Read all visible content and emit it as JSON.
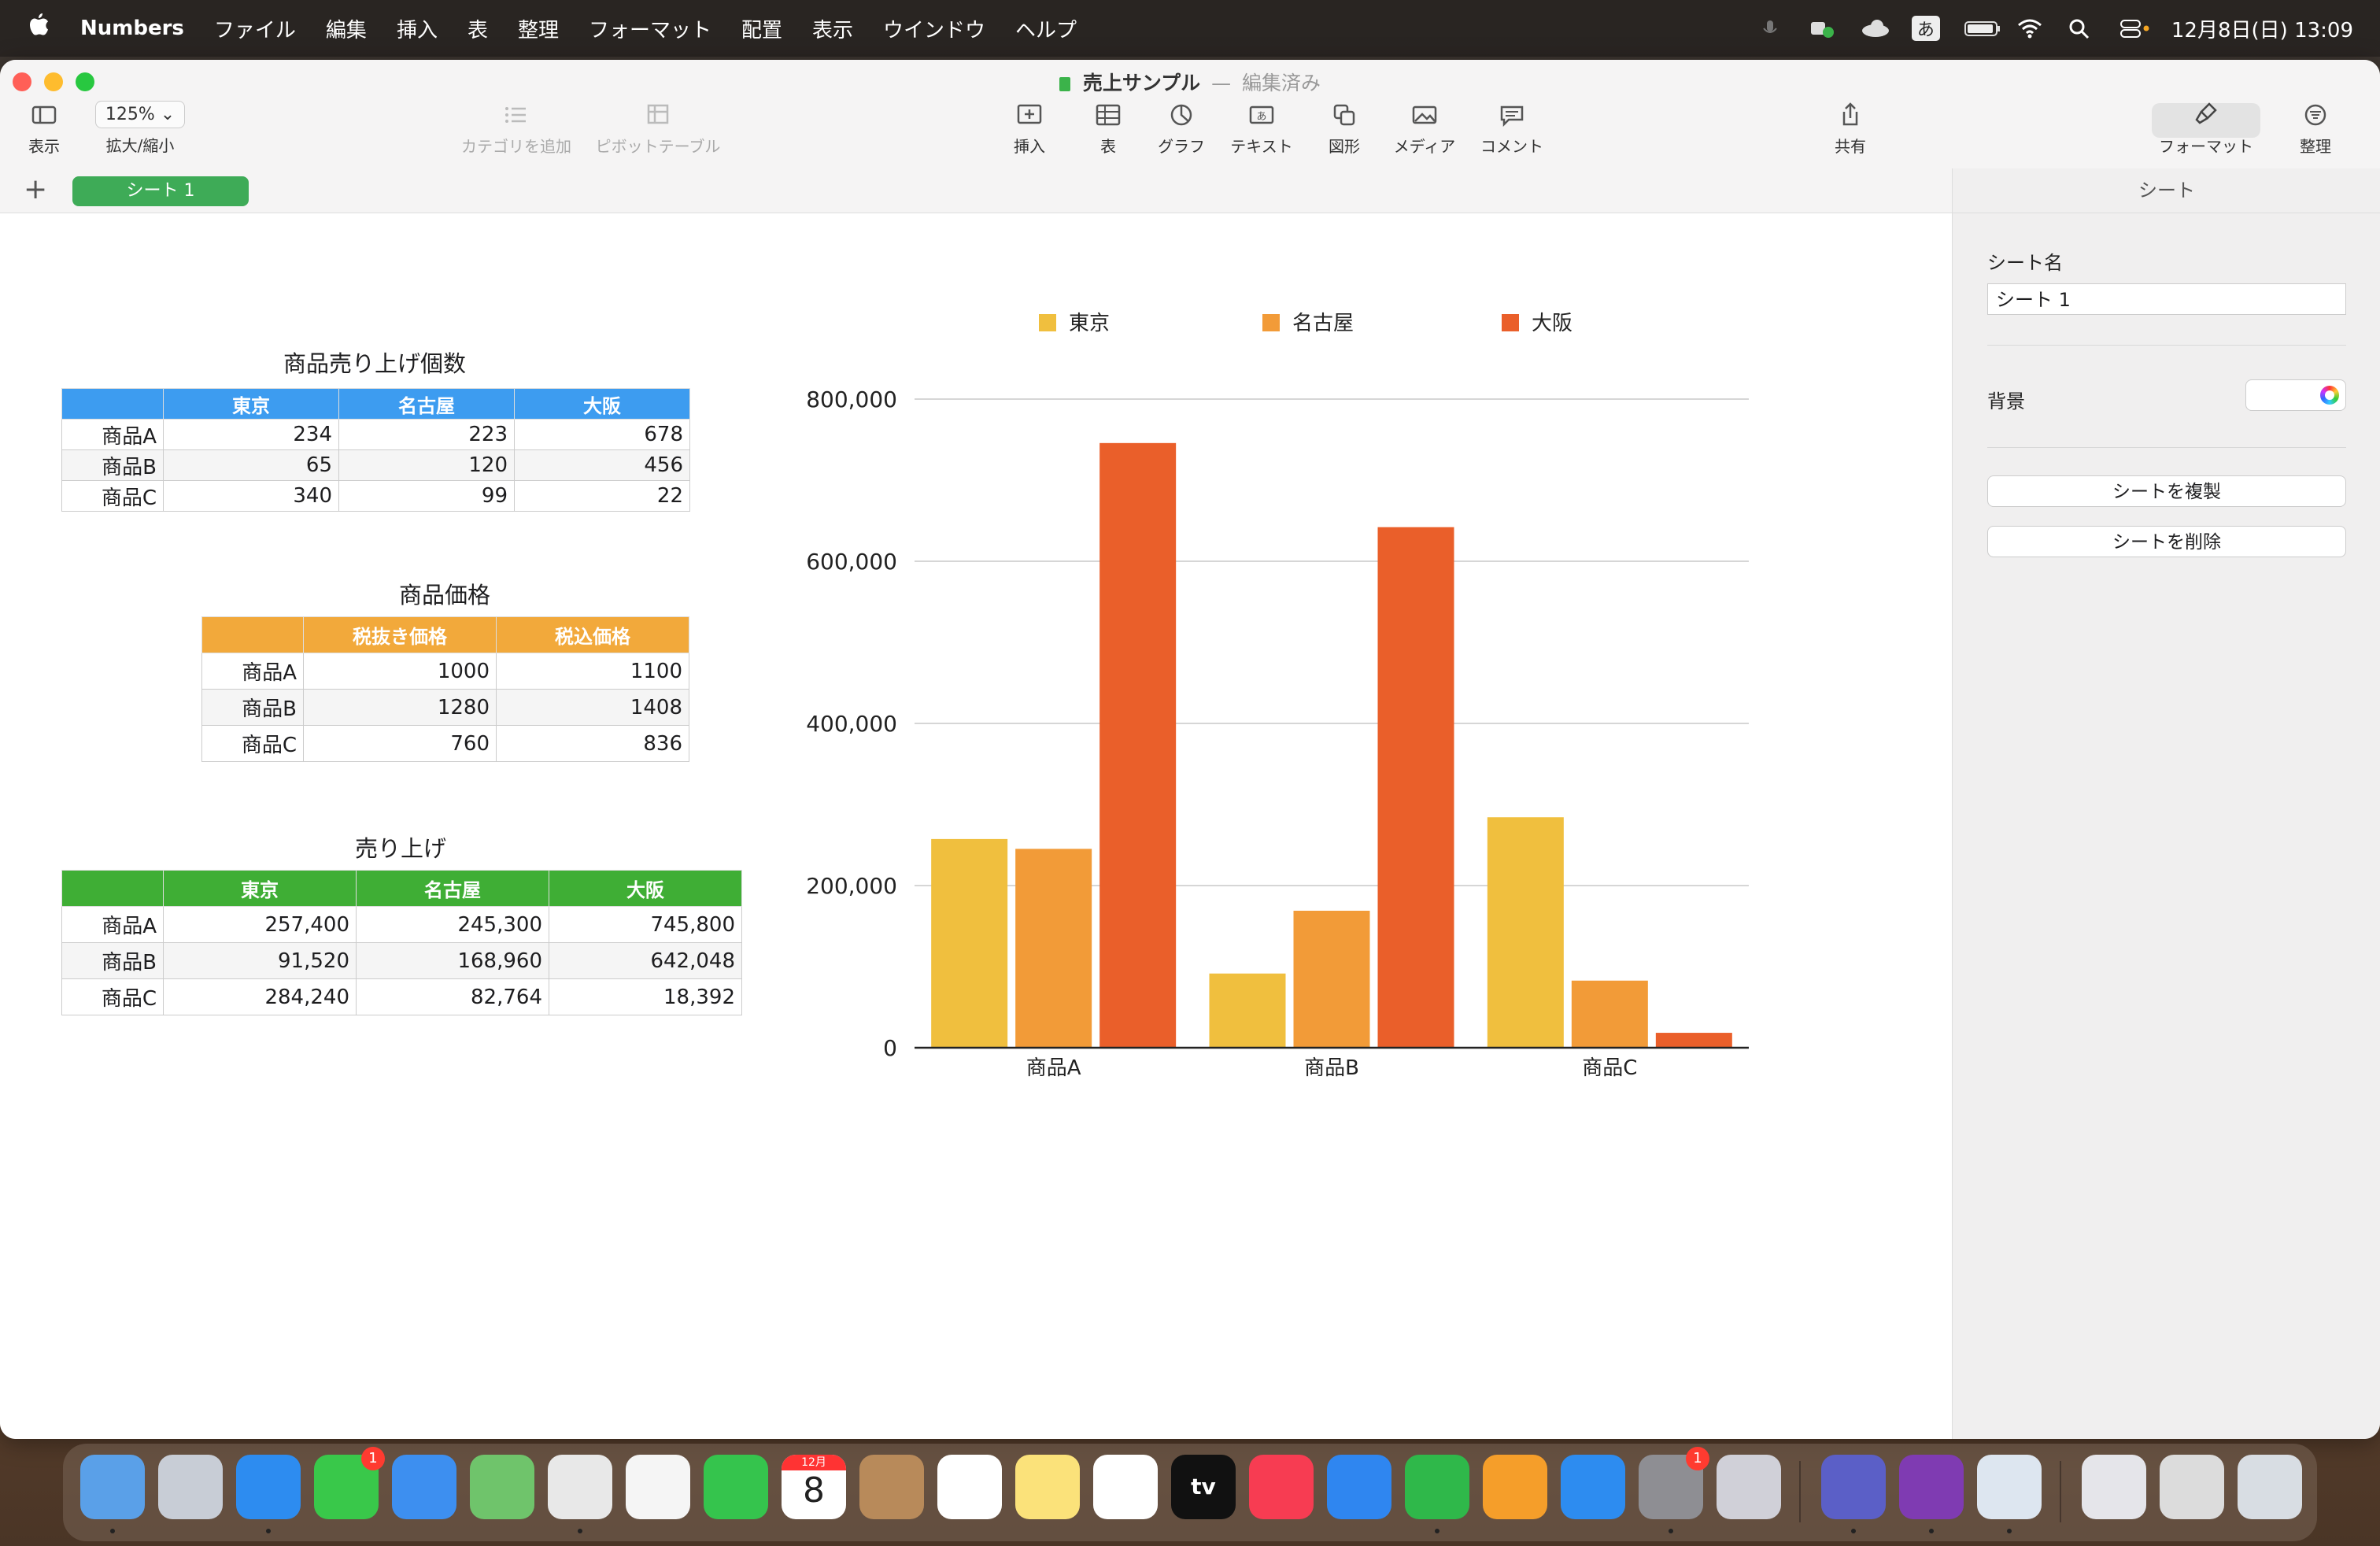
{
  "menubar": {
    "apple": "",
    "items": [
      "Numbers",
      "ファイル",
      "編集",
      "挿入",
      "表",
      "整理",
      "フォーマット",
      "配置",
      "表示",
      "ウインドウ",
      "ヘルプ"
    ],
    "input_method": "あ",
    "datetime": "12月8日(日) 13:09"
  },
  "window": {
    "title": "売上サンプル",
    "title_sep": "—",
    "title_status": "編集済み",
    "toolbar": {
      "view": "表示",
      "zoom_value": "125%",
      "zoom": "拡大/縮小",
      "add_category": "カテゴリを追加",
      "pivot": "ピボットテーブル",
      "insert": "挿入",
      "table": "表",
      "chart": "グラフ",
      "text": "テキスト",
      "shape": "図形",
      "media": "メディア",
      "comment": "コメント",
      "share": "共有",
      "format": "フォーマット",
      "organize": "整理"
    },
    "sheet_tab": "シート 1",
    "add_sheet": "+"
  },
  "sidebar": {
    "header": "シート",
    "sheet_name_label": "シート名",
    "sheet_name_value": "シート 1",
    "background_label": "背景",
    "duplicate_button": "シートを複製",
    "delete_button": "シートを削除"
  },
  "tables": {
    "units": {
      "title": "商品売り上げ個数",
      "header_color": "#3d9cf0",
      "columns": [
        "",
        "東京",
        "名古屋",
        "大阪"
      ],
      "rows": [
        [
          "商品A",
          "234",
          "223",
          "678"
        ],
        [
          "商品B",
          "65",
          "120",
          "456"
        ],
        [
          "商品C",
          "340",
          "99",
          "22"
        ]
      ]
    },
    "price": {
      "title": "商品価格",
      "header_color": "#f2a93b",
      "columns": [
        "",
        "税抜き価格",
        "税込価格"
      ],
      "rows": [
        [
          "商品A",
          "1000",
          "1100"
        ],
        [
          "商品B",
          "1280",
          "1408"
        ],
        [
          "商品C",
          "760",
          "836"
        ]
      ]
    },
    "sales": {
      "title": "売り上げ",
      "header_color": "#3fae35",
      "columns": [
        "",
        "東京",
        "名古屋",
        "大阪"
      ],
      "rows": [
        [
          "商品A",
          "257,400",
          "245,300",
          "745,800"
        ],
        [
          "商品B",
          "91,520",
          "168,960",
          "642,048"
        ],
        [
          "商品C",
          "284,240",
          "82,764",
          "18,392"
        ]
      ]
    }
  },
  "chart_data": {
    "type": "bar",
    "categories": [
      "商品A",
      "商品B",
      "商品C"
    ],
    "series": [
      {
        "name": "東京",
        "values": [
          257400,
          91520,
          284240
        ],
        "color": "#f0bf3e"
      },
      {
        "name": "名古屋",
        "values": [
          245300,
          168960,
          82764
        ],
        "color": "#f29b38"
      },
      {
        "name": "大阪",
        "values": [
          745800,
          642048,
          18392
        ],
        "color": "#ea5f2a"
      }
    ],
    "ylim": [
      0,
      800000
    ],
    "yticks": [
      "0",
      "200,000",
      "400,000",
      "600,000",
      "800,000"
    ],
    "grid": true,
    "legend": "top"
  },
  "dock": {
    "calendar_month": "12月",
    "calendar_day": "8",
    "badge_messages": "1",
    "badge_settings": "1",
    "apps": [
      "finder-icon",
      "launchpad-icon",
      "safari-icon",
      "messages-icon",
      "mail-icon",
      "maps-icon",
      "chrome-icon",
      "photos-icon",
      "facetime-icon",
      "calendar-icon",
      "contacts-icon",
      "reminders-icon",
      "notes-icon",
      "freeform-icon",
      "appletv-icon",
      "music-icon",
      "keynote-icon",
      "numbers-icon",
      "pages-icon",
      "appstore-icon",
      "system-settings-icon",
      "iphone-mirroring-icon",
      "teams-icon",
      "onenote-icon",
      "preview-icon",
      "downloads-icon",
      "keyboard-viewer-icon",
      "trash-icon"
    ]
  }
}
